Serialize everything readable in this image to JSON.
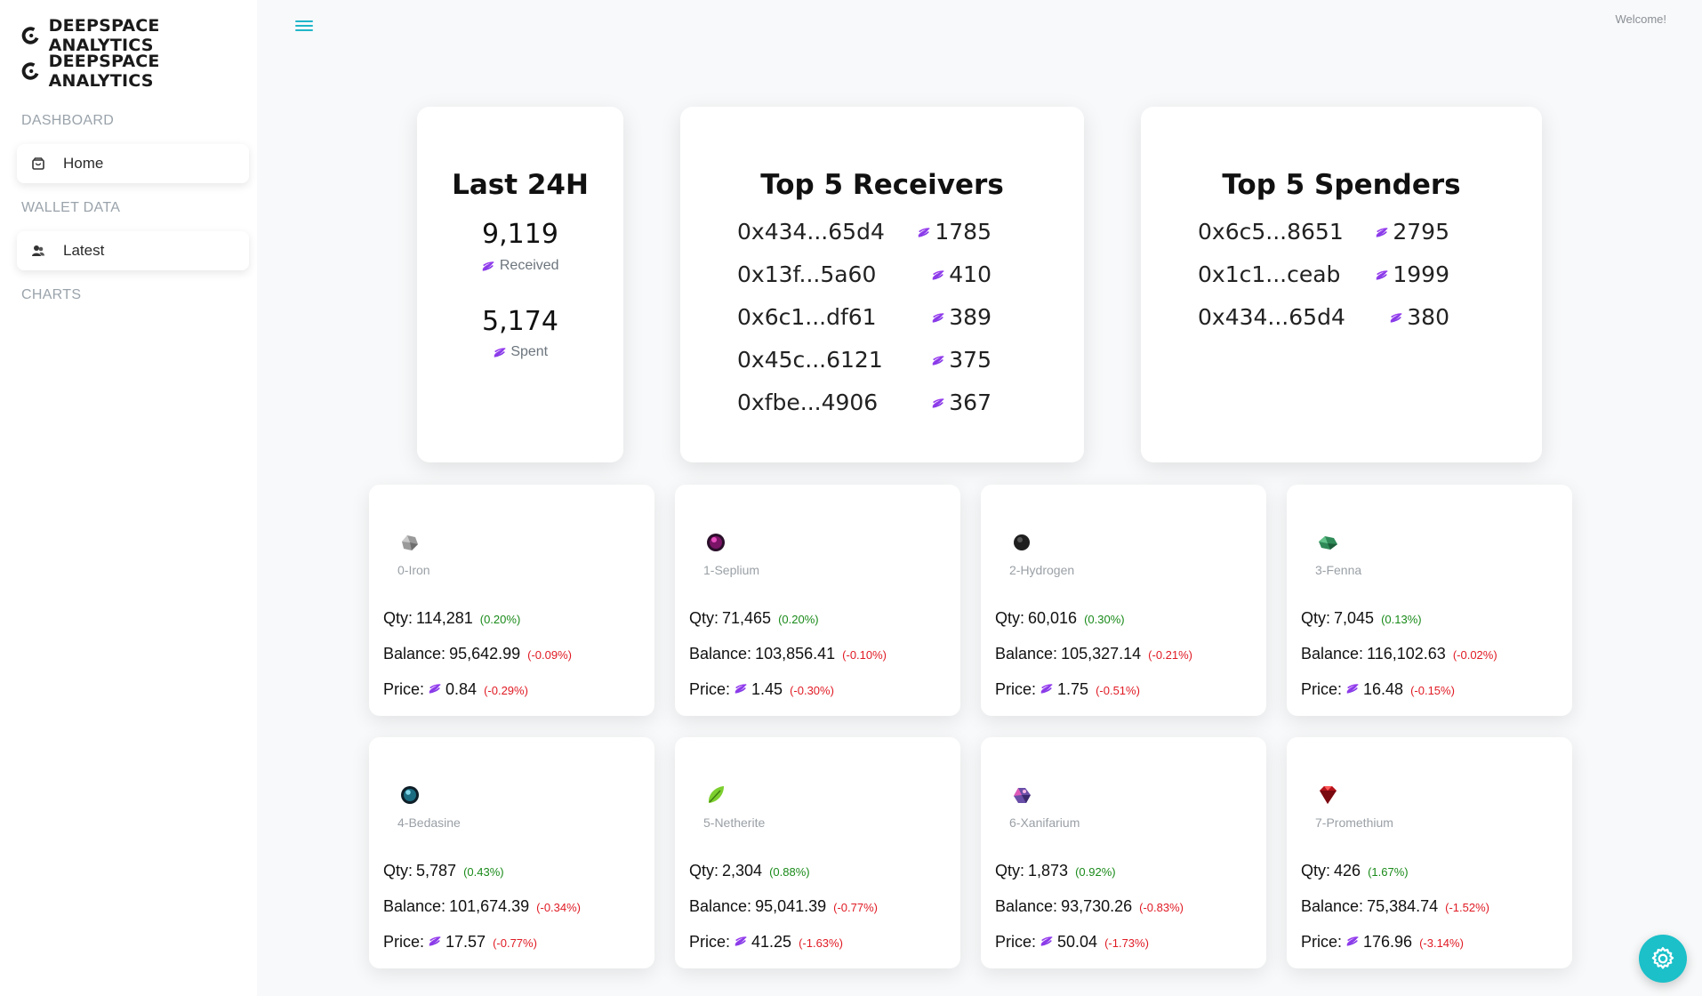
{
  "brand": {
    "name": "DEEPSPACE ANALYTICS"
  },
  "sidebar": {
    "sections": [
      {
        "title": "DASHBOARD",
        "items": [
          {
            "label": "Home",
            "icon": "shopping-bag-icon"
          }
        ]
      },
      {
        "title": "WALLET DATA",
        "items": [
          {
            "label": "Latest",
            "icon": "users-icon"
          }
        ]
      },
      {
        "title": "CHARTS",
        "items": []
      }
    ]
  },
  "header": {
    "welcome": "Welcome!"
  },
  "summary": {
    "title": "Last 24H",
    "received_value": "9,119",
    "received_label": "Received",
    "spent_value": "5,174",
    "spent_label": "Spent"
  },
  "receivers": {
    "title": "Top 5 Receivers",
    "rows": [
      {
        "address": "0x434...65d4",
        "amount": "1785"
      },
      {
        "address": "0x13f...5a60",
        "amount": "410"
      },
      {
        "address": "0x6c1...df61",
        "amount": "389"
      },
      {
        "address": "0x45c...6121",
        "amount": "375"
      },
      {
        "address": "0xfbe...4906",
        "amount": "367"
      }
    ]
  },
  "spenders": {
    "title": "Top 5 Spenders",
    "rows": [
      {
        "address": "0x6c5...8651",
        "amount": "2795"
      },
      {
        "address": "0x1c1...ceab",
        "amount": "1999"
      },
      {
        "address": "0x434...65d4",
        "amount": "380"
      }
    ]
  },
  "labels": {
    "qty": "Qty:",
    "balance": "Balance:",
    "price": "Price:"
  },
  "resources": [
    {
      "name": "0-Iron",
      "icon": "iron-ore-icon",
      "qty": "114,281",
      "qty_change": "(0.20%)",
      "balance": "95,642.99",
      "balance_change": "(-0.09%)",
      "price": "0.84",
      "price_change": "(-0.29%)"
    },
    {
      "name": "1-Seplium",
      "icon": "seplium-orb-icon",
      "qty": "71,465",
      "qty_change": "(0.20%)",
      "balance": "103,856.41",
      "balance_change": "(-0.10%)",
      "price": "1.45",
      "price_change": "(-0.30%)"
    },
    {
      "name": "2-Hydrogen",
      "icon": "hydrogen-orb-icon",
      "qty": "60,016",
      "qty_change": "(0.30%)",
      "balance": "105,327.14",
      "balance_change": "(-0.21%)",
      "price": "1.75",
      "price_change": "(-0.51%)"
    },
    {
      "name": "3-Fenna",
      "icon": "fenna-crystal-icon",
      "qty": "7,045",
      "qty_change": "(0.13%)",
      "balance": "116,102.63",
      "balance_change": "(-0.02%)",
      "price": "16.48",
      "price_change": "(-0.15%)"
    },
    {
      "name": "4-Bedasine",
      "icon": "bedasine-orb-icon",
      "qty": "5,787",
      "qty_change": "(0.43%)",
      "balance": "101,674.39",
      "balance_change": "(-0.34%)",
      "price": "17.57",
      "price_change": "(-0.77%)"
    },
    {
      "name": "5-Netherite",
      "icon": "netherite-leaf-icon",
      "qty": "2,304",
      "qty_change": "(0.88%)",
      "balance": "95,041.39",
      "balance_change": "(-0.77%)",
      "price": "41.25",
      "price_change": "(-1.63%)"
    },
    {
      "name": "6-Xanifarium",
      "icon": "xanifarium-crystal-icon",
      "qty": "1,873",
      "qty_change": "(0.92%)",
      "balance": "93,730.26",
      "balance_change": "(-0.83%)",
      "price": "50.04",
      "price_change": "(-1.73%)"
    },
    {
      "name": "7-Promethium",
      "icon": "promethium-gem-icon",
      "qty": "426",
      "qty_change": "(1.67%)",
      "balance": "75,384.74",
      "balance_change": "(-1.52%)",
      "price": "176.96",
      "price_change": "(-3.14%)"
    }
  ],
  "colors": {
    "accent": "#1bc0c9",
    "positive": "#198a19",
    "negative": "#e01b24",
    "coin": "#8a2be2"
  }
}
